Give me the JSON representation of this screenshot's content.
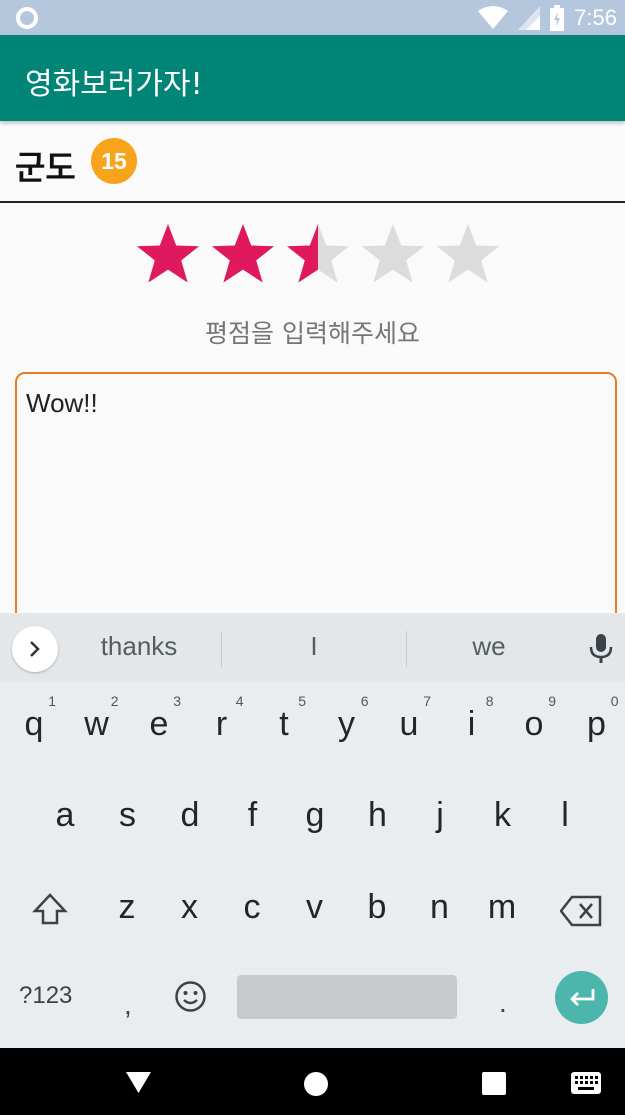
{
  "status_bar": {
    "time": "7:56"
  },
  "app_bar": {
    "title": "영화보러가자!"
  },
  "movie": {
    "title": "군도",
    "age_rating": "15"
  },
  "rating": {
    "value": 2.5,
    "max": 5,
    "hint": "평점을 입력해주세요",
    "filled_color": "#e0195f",
    "empty_color": "#dcdcdc"
  },
  "review": {
    "text": "Wow!!"
  },
  "keyboard": {
    "suggestions": [
      "thanks",
      "I",
      "we"
    ],
    "row1": [
      {
        "key": "q",
        "hint": "1"
      },
      {
        "key": "w",
        "hint": "2"
      },
      {
        "key": "e",
        "hint": "3"
      },
      {
        "key": "r",
        "hint": "4"
      },
      {
        "key": "t",
        "hint": "5"
      },
      {
        "key": "y",
        "hint": "6"
      },
      {
        "key": "u",
        "hint": "7"
      },
      {
        "key": "i",
        "hint": "8"
      },
      {
        "key": "o",
        "hint": "9"
      },
      {
        "key": "p",
        "hint": "0"
      }
    ],
    "row2": [
      "a",
      "s",
      "d",
      "f",
      "g",
      "h",
      "j",
      "k",
      "l"
    ],
    "row3": [
      "z",
      "x",
      "c",
      "v",
      "b",
      "n",
      "m"
    ],
    "symbols_label": "?123",
    "comma": ",",
    "period": "."
  },
  "icons": {
    "status": [
      "circle-indicator-icon",
      "wifi-icon",
      "signal-icon",
      "battery-icon"
    ],
    "keyboard": [
      "expand-suggestions-icon",
      "mic-icon",
      "shift-icon",
      "backspace-icon",
      "emoji-icon",
      "enter-icon"
    ],
    "nav": [
      "back-icon",
      "home-icon",
      "recents-icon",
      "keyboard-switch-icon"
    ]
  }
}
